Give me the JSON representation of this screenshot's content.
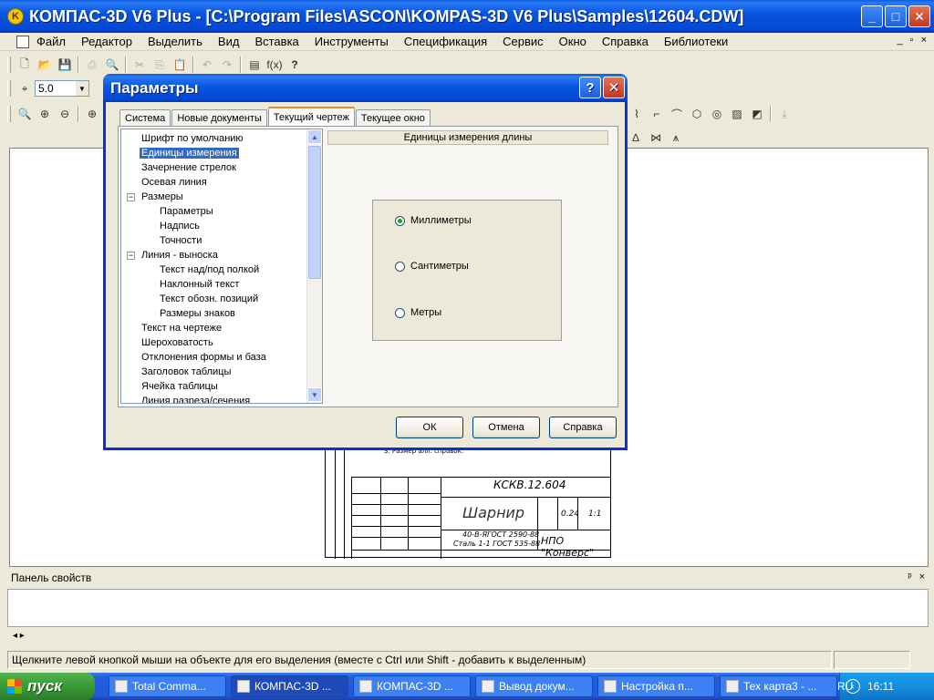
{
  "window": {
    "title": "КОМПАС-3D V6 Plus - [C:\\Program Files\\ASCON\\KOMPAS-3D V6 Plus\\Samples\\12604.CDW]",
    "app_icon": "K",
    "min": "_",
    "max": "□",
    "close": "✕"
  },
  "menu": [
    "Файл",
    "Редактор",
    "Выделить",
    "Вид",
    "Вставка",
    "Инструменты",
    "Спецификация",
    "Сервис",
    "Окно",
    "Справка",
    "Библиотеки"
  ],
  "mdi_controls": [
    "_",
    "▫",
    "×"
  ],
  "toolbar": {
    "step_value": "5.0",
    "fx_label": "f(x)",
    "help_label": "?"
  },
  "drawing": {
    "designation": "КСКВ.12.604",
    "part_name": "Шарнир",
    "material_1": "40-В-ЯГОСТ 2590-88",
    "material_2": "Сталь 1-1 ГОСТ 535-88",
    "organization": "НПО \"Конверс\"",
    "mass": "0.24",
    "scale": "1:1",
    "note": "3. Размер алл. справок."
  },
  "dialog": {
    "title": "Параметры",
    "help_btn": "?",
    "close_btn": "✕",
    "tabs": [
      "Система",
      "Новые документы",
      "Текущий чертеж",
      "Текущее окно"
    ],
    "active_tab": 2,
    "tree": [
      {
        "label": "Шрифт по умолчанию",
        "level": 0
      },
      {
        "label": "Единицы измерения",
        "level": 0,
        "selected": true
      },
      {
        "label": "Зачернение стрелок",
        "level": 0
      },
      {
        "label": "Осевая линия",
        "level": 0
      },
      {
        "label": "Размеры",
        "level": 0,
        "expander": "−"
      },
      {
        "label": "Параметры",
        "level": 1
      },
      {
        "label": "Надпись",
        "level": 1
      },
      {
        "label": "Точности",
        "level": 1
      },
      {
        "label": "Линия - выноска",
        "level": 0,
        "expander": "−"
      },
      {
        "label": "Текст над/под полкой",
        "level": 1
      },
      {
        "label": "Наклонный текст",
        "level": 1
      },
      {
        "label": "Текст обозн. позиций",
        "level": 1
      },
      {
        "label": "Размеры знаков",
        "level": 1
      },
      {
        "label": "Текст на чертеже",
        "level": 0
      },
      {
        "label": "Шероховатость",
        "level": 0
      },
      {
        "label": "Отклонения формы и база",
        "level": 0
      },
      {
        "label": "Заголовок таблицы",
        "level": 0
      },
      {
        "label": "Ячейка таблицы",
        "level": 0
      },
      {
        "label": "Линия разреза/сечения",
        "level": 0
      }
    ],
    "group_title": "Единицы измерения длины",
    "radios": [
      {
        "label": "Миллиметры",
        "checked": true
      },
      {
        "label": "Сантиметры",
        "checked": false
      },
      {
        "label": "Метры",
        "checked": false
      }
    ],
    "ok": "ОК",
    "cancel": "Отмена",
    "help": "Справка"
  },
  "property_panel": {
    "title": "Панель свойств",
    "pin": "ᵖ",
    "close": "×",
    "nav": "◂ ▸"
  },
  "status": {
    "message": "Щелкните левой кнопкой мыши на объекте для его выделения (вместе с Ctrl или Shift - добавить к выделенным)"
  },
  "taskbar": {
    "start": "пуск",
    "tasks": [
      {
        "label": "Total Comma...",
        "active": false
      },
      {
        "label": "КОМПАС-3D ...",
        "active": true
      },
      {
        "label": "КОМПАС-3D ...",
        "active": false
      },
      {
        "label": "Вывод докум...",
        "active": false
      },
      {
        "label": "Настройка п...",
        "active": false
      },
      {
        "label": "Тех карта3 - ...",
        "active": false
      }
    ],
    "lang": "RU",
    "clock": "16:11"
  }
}
